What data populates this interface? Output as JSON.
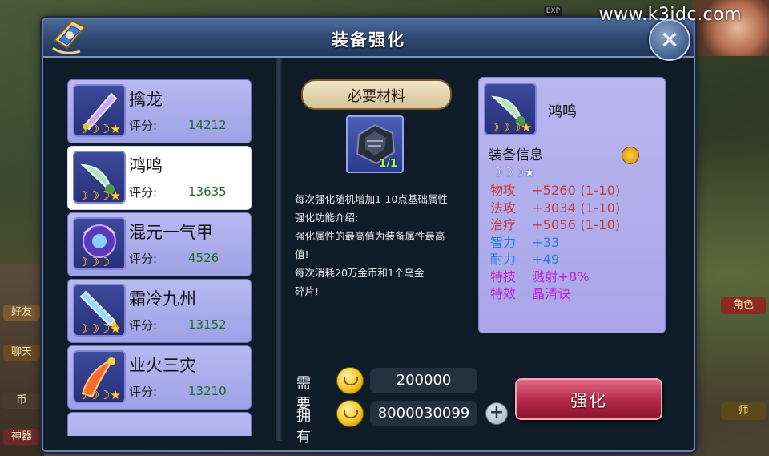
{
  "watermark": "www.k3idc.com",
  "top_right": {
    "exp_tag": "EXP"
  },
  "background": {
    "left_chips": [
      "好友",
      "聊天",
      "币",
      "神器"
    ],
    "right_chips": [
      "角色",
      "师"
    ]
  },
  "dialog": {
    "title": "装备强化",
    "close_label": "×"
  },
  "equipment_list": [
    {
      "name": "擒龙",
      "score_label": "评分:",
      "score": "14212",
      "stars": "☽☽☽★",
      "selected": false,
      "icon": "sword-icon"
    },
    {
      "name": "鸿鸣",
      "score_label": "评分:",
      "score": "13635",
      "stars": "☽☽☽★",
      "selected": true,
      "icon": "blade-icon"
    },
    {
      "name": "混元一气甲",
      "score_label": "评分:",
      "score": "4526",
      "stars": "☽☽☽",
      "selected": false,
      "icon": "armor-icon"
    },
    {
      "name": "霜冷九州",
      "score_label": "评分:",
      "score": "13152",
      "stars": "☽☽☽★",
      "selected": false,
      "icon": "ice-sword-icon"
    },
    {
      "name": "业火三灾",
      "score_label": "评分:",
      "score": "13210",
      "stars": "☽☽☽★",
      "selected": false,
      "icon": "fire-sword-icon"
    }
  ],
  "materials": {
    "header": "必要材料",
    "item_icon": "ore-icon",
    "count": "1/1"
  },
  "description": [
    "每次强化随机增加1-10点基础属性",
    "强化功能介绍:",
    "强化属性的最高值为装备属性最高",
    "值!",
    "每次消耗20万金币和1个乌金",
    "碎片!"
  ],
  "cost": {
    "need_label": "需要",
    "need_value": "200000",
    "have_label": "拥有",
    "have_value": "8000030099",
    "plus_label": "+"
  },
  "enhance_button": "强化",
  "info_card": {
    "name": "鸿鸣",
    "section": "装备信息",
    "stars": "☽☽☽★",
    "stats": [
      {
        "key": "物攻",
        "value": "+5260 (1-10)",
        "color": "#c83a3a"
      },
      {
        "key": "法攻",
        "value": "+3034 (1-10)",
        "color": "#c83a3a"
      },
      {
        "key": "治疗",
        "value": "+5056 (1-10)",
        "color": "#c83a3a"
      },
      {
        "key": "智力",
        "value": "+33",
        "color": "#2a7ae8"
      },
      {
        "key": "耐力",
        "value": "+49",
        "color": "#2a7ae8"
      },
      {
        "key": "特技",
        "value": "溅射+8%",
        "color": "#c21fd0"
      },
      {
        "key": "特效",
        "value": "晶清诀",
        "color": "#c21fd0"
      }
    ]
  }
}
